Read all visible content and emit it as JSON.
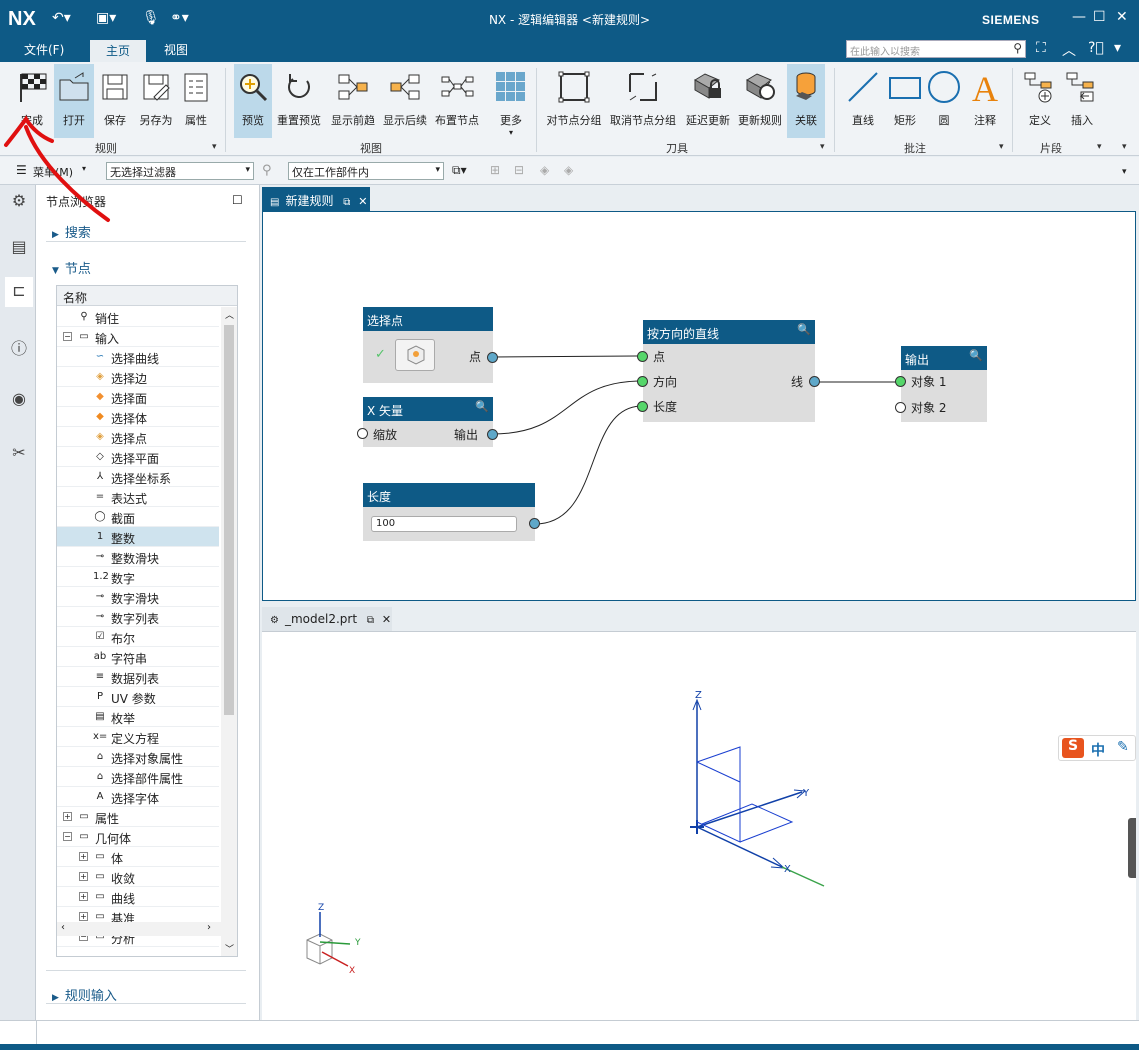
{
  "app": {
    "logo": "NX",
    "title": "NX - 逻辑编辑器 <新建规则>",
    "brand": "SIEMENS"
  },
  "menu": {
    "file": "文件(F)",
    "home": "主页",
    "view": "视图",
    "search_placeholder": "在此输入以搜索"
  },
  "ribbon": {
    "buttons": [
      {
        "label": "完成",
        "icon": "checkered-flag-icon"
      },
      {
        "label": "打开",
        "icon": "open-folder-icon"
      },
      {
        "label": "保存",
        "icon": "save-icon"
      },
      {
        "label": "另存为",
        "icon": "save-as-icon"
      },
      {
        "label": "属性",
        "icon": "properties-icon"
      },
      {
        "label": "预览",
        "icon": "preview-icon"
      },
      {
        "label": "重置预览",
        "icon": "reset-preview-icon"
      },
      {
        "label": "显示前趋",
        "icon": "show-predecessors-icon"
      },
      {
        "label": "显示后续",
        "icon": "show-successors-icon"
      },
      {
        "label": "布置节点",
        "icon": "arrange-nodes-icon"
      },
      {
        "label": "更多",
        "icon": "more-grid-icon"
      },
      {
        "label": "对节点分组",
        "icon": "group-nodes-icon"
      },
      {
        "label": "取消节点分组",
        "icon": "ungroup-nodes-icon"
      },
      {
        "label": "延迟更新",
        "icon": "delay-update-icon"
      },
      {
        "label": "更新规则",
        "icon": "update-rule-icon"
      },
      {
        "label": "关联",
        "icon": "associate-icon"
      },
      {
        "label": "直线",
        "icon": "line-icon"
      },
      {
        "label": "矩形",
        "icon": "rectangle-icon"
      },
      {
        "label": "圆",
        "icon": "circle-icon"
      },
      {
        "label": "注释",
        "icon": "annotation-icon"
      },
      {
        "label": "定义",
        "icon": "define-icon"
      },
      {
        "label": "插入",
        "icon": "insert-icon"
      }
    ],
    "groups": [
      "规则",
      "视图",
      "刀具",
      "批注",
      "片段"
    ]
  },
  "filters": {
    "menu": "菜单(M)",
    "selection_filter": "无选择过滤器",
    "scope": "仅在工作部件内"
  },
  "browser": {
    "title": "节点浏览器",
    "search": "搜索",
    "nodes": "节点",
    "column": "名称",
    "rule_inputs": "规则输入",
    "items": [
      {
        "label": "销住",
        "level": 0,
        "icon": "pin-icon"
      },
      {
        "label": "输入",
        "level": 0,
        "icon": "folder-icon",
        "expanded": true
      },
      {
        "label": "选择曲线",
        "level": 1,
        "icon": "curve-icon"
      },
      {
        "label": "选择边",
        "level": 1,
        "icon": "edge-icon"
      },
      {
        "label": "选择面",
        "level": 1,
        "icon": "face-icon"
      },
      {
        "label": "选择体",
        "level": 1,
        "icon": "body-icon"
      },
      {
        "label": "选择点",
        "level": 1,
        "icon": "point-icon"
      },
      {
        "label": "选择平面",
        "level": 1,
        "icon": "plane-icon"
      },
      {
        "label": "选择坐标系",
        "level": 1,
        "icon": "csys-icon"
      },
      {
        "label": "表达式",
        "level": 1,
        "icon": "expression-icon"
      },
      {
        "label": "截面",
        "level": 1,
        "icon": "section-icon"
      },
      {
        "label": "整数",
        "level": 1,
        "icon": "integer-icon",
        "highlight": true
      },
      {
        "label": "整数滑块",
        "level": 1,
        "icon": "integer-slider-icon"
      },
      {
        "label": "数字",
        "level": 1,
        "icon": "number-icon"
      },
      {
        "label": "数字滑块",
        "level": 1,
        "icon": "number-slider-icon"
      },
      {
        "label": "数字列表",
        "level": 1,
        "icon": "number-list-icon"
      },
      {
        "label": "布尔",
        "level": 1,
        "icon": "boolean-icon"
      },
      {
        "label": "字符串",
        "level": 1,
        "icon": "string-icon"
      },
      {
        "label": "数据列表",
        "level": 1,
        "icon": "data-list-icon"
      },
      {
        "label": "UV 参数",
        "level": 1,
        "icon": "uv-param-icon"
      },
      {
        "label": "枚举",
        "level": 1,
        "icon": "enum-icon"
      },
      {
        "label": "定义方程",
        "level": 1,
        "icon": "equation-icon"
      },
      {
        "label": "选择对象属性",
        "level": 1,
        "icon": "object-attr-icon"
      },
      {
        "label": "选择部件属性",
        "level": 1,
        "icon": "part-attr-icon"
      },
      {
        "label": "选择字体",
        "level": 1,
        "icon": "font-icon"
      },
      {
        "label": "属性",
        "level": 0,
        "icon": "folder-icon",
        "expanded": false
      },
      {
        "label": "几何体",
        "level": 0,
        "icon": "folder-icon",
        "expanded": true
      },
      {
        "label": "体",
        "level": 1,
        "icon": "folder-icon",
        "expanded": false
      },
      {
        "label": "收敛",
        "level": 1,
        "icon": "folder-icon",
        "expanded": false
      },
      {
        "label": "曲线",
        "level": 1,
        "icon": "folder-icon",
        "expanded": false
      },
      {
        "label": "基准",
        "level": 1,
        "icon": "folder-icon",
        "expanded": false
      },
      {
        "label": "分析",
        "level": 1,
        "icon": "folder-icon",
        "expanded": true
      }
    ]
  },
  "tabs": {
    "rule": "新建规则",
    "model": "_model2.prt"
  },
  "graph": {
    "nodes": {
      "select_point": {
        "title": "选择点",
        "out": "点"
      },
      "x_vector": {
        "title": "X 矢量",
        "in": "缩放",
        "out": "输出"
      },
      "length": {
        "title": "长度",
        "value": "100"
      },
      "line_along": {
        "title": "按方向的直线",
        "in1": "点",
        "in2": "方向",
        "in3": "长度",
        "out": "线"
      },
      "output": {
        "title": "输出",
        "in1": "对象 1",
        "in2": "对象 2"
      }
    }
  },
  "view3d": {
    "z": "Z",
    "y": "Y",
    "x": "X"
  },
  "ime": {
    "label": "中"
  }
}
